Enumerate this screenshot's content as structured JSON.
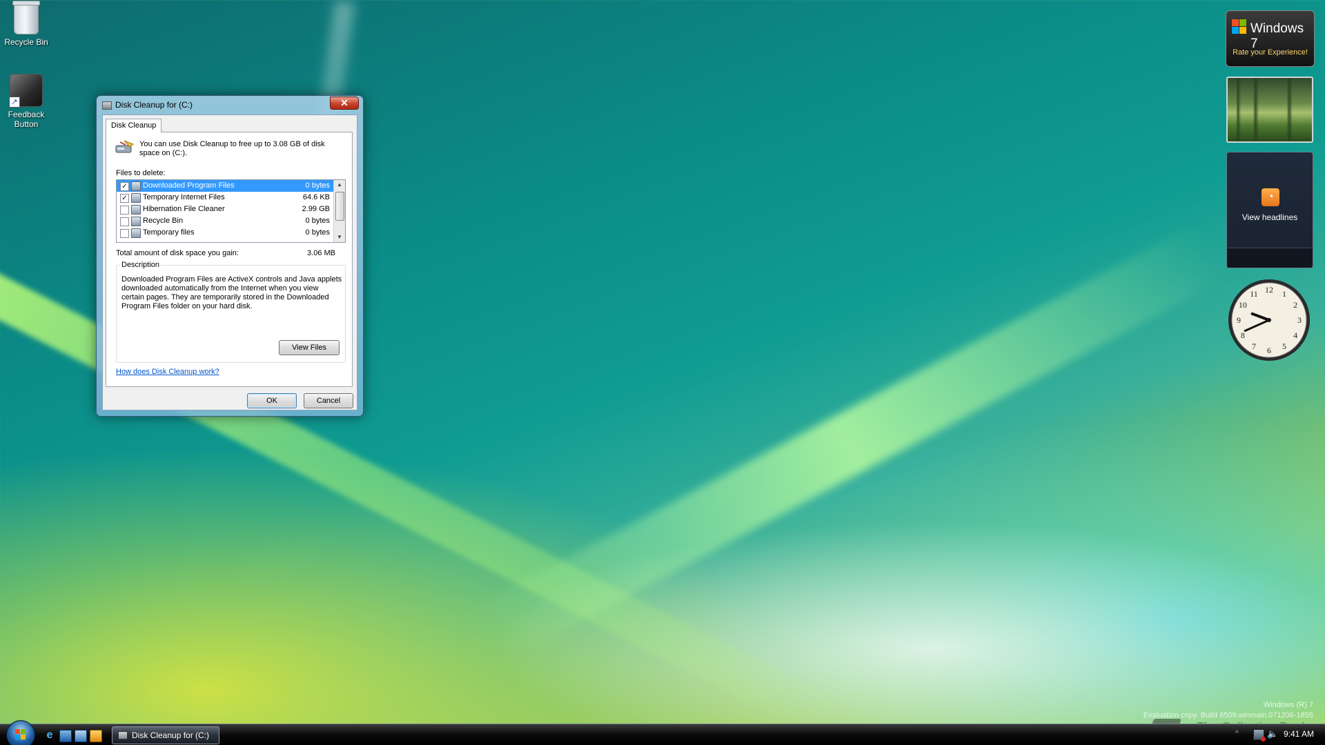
{
  "desktop": {
    "icons": [
      {
        "label": "Recycle Bin",
        "icon": "recycle-bin-icon"
      },
      {
        "label": "Feedback Button",
        "icon": "feedback-icon"
      }
    ],
    "build_line1": "Windows (R) 7",
    "build_line2": "Evaluation copy. Build 6509.winmain.071206-1855",
    "watermark": "The Collection Book"
  },
  "dialog": {
    "title": "Disk Cleanup for  (C:)",
    "close_symbol": "✕",
    "tab_label": "Disk Cleanup",
    "info_text": "You can use Disk Cleanup to free up to 3.08 GB of disk space on  (C:).",
    "files_label": "Files to delete:",
    "files": [
      {
        "name": "Downloaded Program Files",
        "size": "0 bytes",
        "checked": true,
        "selected": true
      },
      {
        "name": "Temporary Internet Files",
        "size": "64.6 KB",
        "checked": true,
        "selected": false
      },
      {
        "name": "Hibernation File Cleaner",
        "size": "2.99 GB",
        "checked": false,
        "selected": false
      },
      {
        "name": "Recycle Bin",
        "size": "0 bytes",
        "checked": false,
        "selected": false
      },
      {
        "name": "Temporary files",
        "size": "0 bytes",
        "checked": false,
        "selected": false
      }
    ],
    "total_label": "Total amount of disk space you gain:",
    "total_value": "3.06 MB",
    "description_title": "Description",
    "description_text": "Downloaded Program Files are ActiveX controls and Java applets downloaded automatically from the Internet when you view certain pages. They are temporarily stored in the Downloaded Program Files folder on your hard disk.",
    "view_files_label": "View Files",
    "help_link": "How does Disk Cleanup work?",
    "ok_label": "OK",
    "cancel_label": "Cancel"
  },
  "gadgets": {
    "win7_title": "Windows 7",
    "win7_subtitle": "Rate your Experience!",
    "rss_label": "View headlines",
    "clock_numbers": [
      "12",
      "1",
      "2",
      "3",
      "4",
      "5",
      "6",
      "7",
      "8",
      "9",
      "10",
      "11"
    ],
    "clock_hour": 9,
    "clock_minute": 41
  },
  "taskbar": {
    "task_label": "Disk Cleanup for  (C:)",
    "time": "9:41 AM",
    "tray_chevron": "^"
  },
  "colors": {
    "accent_selection": "#3399ff",
    "link": "#0055cc",
    "rss": "#e8741c"
  }
}
